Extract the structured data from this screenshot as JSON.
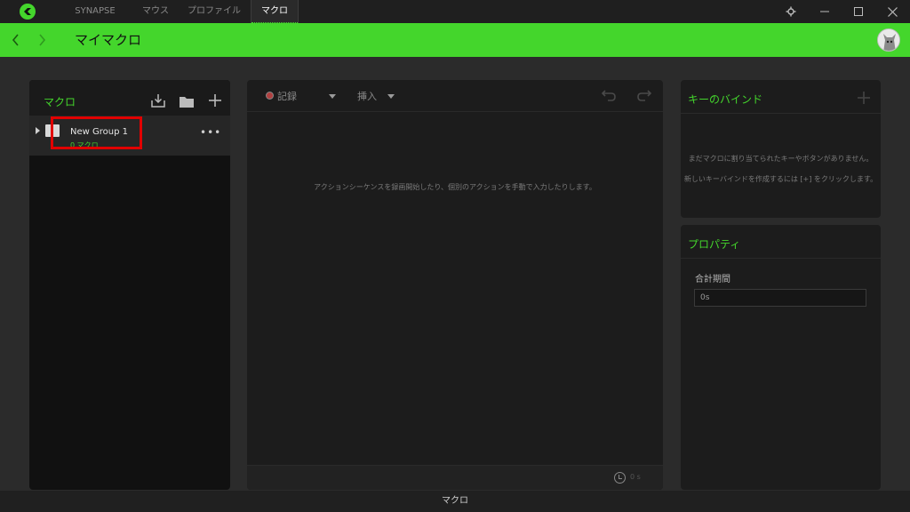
{
  "titlebar": {
    "tabs": [
      {
        "label": "SYNAPSE"
      },
      {
        "label": "マウス"
      },
      {
        "label": "プロファイル"
      },
      {
        "label": "マクロ"
      }
    ],
    "active_tab": "マクロ",
    "accent": "#44d62c"
  },
  "header": {
    "title": "マイマクロ",
    "back_icon": "chevron-left-icon",
    "forward_icon": "chevron-right-icon"
  },
  "macro_list": {
    "title": "マクロ",
    "groups": [
      {
        "name": "New Group 1",
        "count": "0 マクロ"
      }
    ],
    "more_label": "•••"
  },
  "editor": {
    "record_label": "記録",
    "insert_label": "挿入",
    "empty_message": "アクションシーケンスを録画開始したり、個別のアクションを手動で入力したりします。",
    "total_time": "0 s"
  },
  "keybinds": {
    "title": "キーのバインド",
    "add_label": "+",
    "message_1": "まだマクロに割り当てられたキーやボタンがありません。",
    "message_2": "新しいキーバインドを作成するには [+] をクリックします。"
  },
  "properties": {
    "title": "プロパティ",
    "duration_label": "合計期間",
    "duration_value": "0s"
  },
  "status_bar": {
    "label": "マクロ"
  }
}
